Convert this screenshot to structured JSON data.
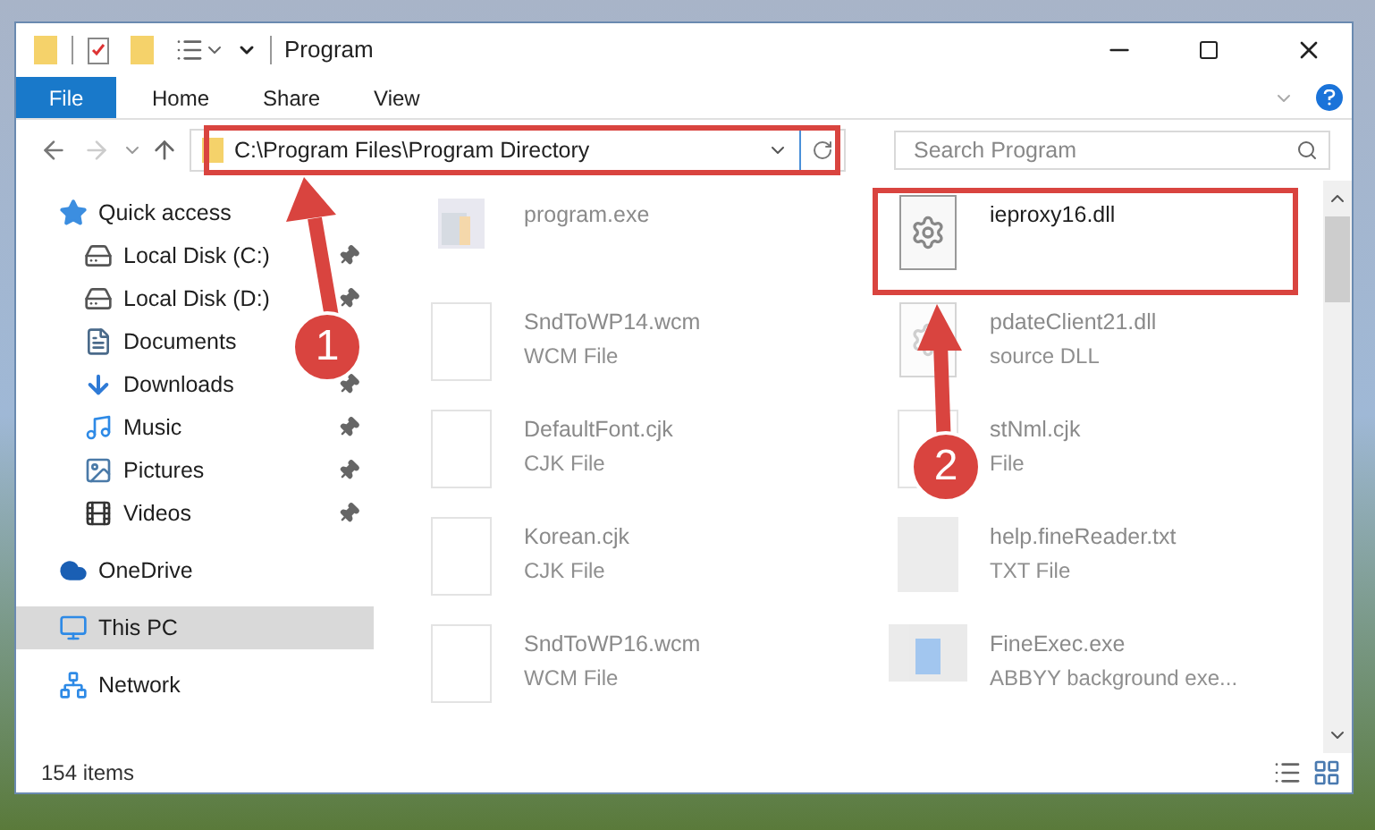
{
  "window": {
    "title": "Program"
  },
  "ribbon_tabs": [
    {
      "label": "File",
      "selected": true
    },
    {
      "label": "Home",
      "selected": false
    },
    {
      "label": "Share",
      "selected": false
    },
    {
      "label": "View",
      "selected": false
    }
  ],
  "address": {
    "path": "C:\\Program Files\\Program Directory"
  },
  "search": {
    "placeholder": "Search Program"
  },
  "sidebar": {
    "items": [
      {
        "label": "Quick access",
        "kind": "star",
        "selected": false,
        "children": [
          {
            "label": "Local Disk (C:)",
            "kind": "disk-c",
            "pinned": true,
            "selected": false
          },
          {
            "label": "Local Disk (D:)",
            "kind": "disk",
            "pinned": true,
            "selected": false
          },
          {
            "label": "Documents",
            "kind": "documents",
            "selected": false
          },
          {
            "label": "Downloads",
            "kind": "downloads",
            "pinned": true,
            "selected": false
          },
          {
            "label": "Music",
            "kind": "music",
            "pinned": true,
            "selected": false
          },
          {
            "label": "Pictures",
            "kind": "pictures",
            "pinned": true,
            "selected": false
          },
          {
            "label": "Videos",
            "kind": "videos",
            "pinned": true,
            "selected": false
          }
        ]
      },
      {
        "label": "OneDrive",
        "kind": "cloud",
        "selected": false
      },
      {
        "label": "This PC",
        "kind": "pc",
        "selected": true
      },
      {
        "label": "Network",
        "kind": "network",
        "selected": false
      }
    ]
  },
  "files": [
    {
      "name": "program.exe",
      "kind": "exe",
      "highlighted": false
    },
    {
      "name": "ieproxy16.dll",
      "kind": "dll",
      "highlighted": true
    },
    {
      "name": "SndToWP14.wcm",
      "type": "WCM File",
      "kind": "doc",
      "highlighted": false
    },
    {
      "name": "pdateClient21.dll",
      "type": "source DLL",
      "kind": "dll",
      "highlighted": false
    },
    {
      "name": "DefaultFont.cjk",
      "type": "CJK File",
      "kind": "doc",
      "highlighted": false
    },
    {
      "name": "stNml.cjk",
      "type": "File",
      "kind": "doc",
      "highlighted": false
    },
    {
      "name": "Korean.cjk",
      "type": "CJK File",
      "kind": "doc",
      "highlighted": false
    },
    {
      "name": "help.fineReader.txt",
      "type": "TXT File",
      "kind": "txt",
      "highlighted": false
    },
    {
      "name": "SndToWP16.wcm",
      "type": "WCM File",
      "kind": "doc",
      "highlighted": false
    },
    {
      "name": "FineExec.exe",
      "type": "ABBYY background exe...",
      "kind": "app",
      "highlighted": false
    }
  ],
  "status_bar": {
    "count": "154 items"
  },
  "annotations": [
    {
      "label": "1"
    },
    {
      "label": "2"
    }
  ]
}
